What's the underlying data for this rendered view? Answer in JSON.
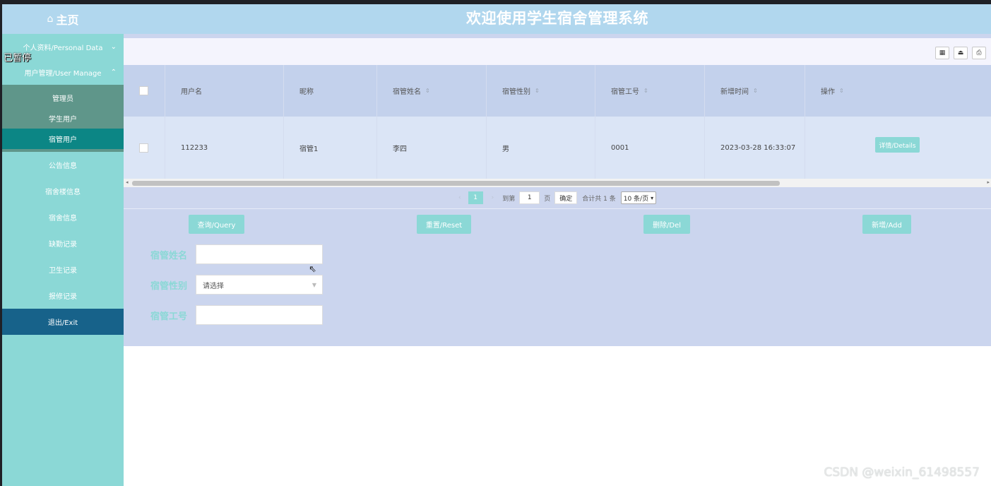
{
  "header": {
    "home_label": "主页",
    "home_icon": "home-icon",
    "title": "欢迎使用学生宿舍管理系统"
  },
  "overlay": {
    "paused": "已暂停"
  },
  "sidebar": {
    "personal": {
      "label": "个人资料/Personal Data",
      "chevron": "chevron-down-icon"
    },
    "user_manage": {
      "label": "用户管理/User Manage",
      "chevron": "chevron-up-icon"
    },
    "sub_items": [
      "管理员",
      "学生用户",
      "宿管用户"
    ],
    "active_sub_index": 2,
    "items": [
      "公告信息",
      "宿舍楼信息",
      "宿舍信息",
      "缺勤记录",
      "卫生记录",
      "报修记录"
    ],
    "exit_label": "退出/Exit"
  },
  "toolbar": {
    "icons": [
      "qr-code-icon",
      "export-icon",
      "print-icon"
    ]
  },
  "table": {
    "headers": [
      "用户名",
      "昵称",
      "宿管姓名",
      "宿管性别",
      "宿管工号",
      "新增时间",
      "操作"
    ],
    "rows": [
      {
        "username": "112233",
        "nickname": "宿管1",
        "name": "李四",
        "gender": "男",
        "work_no": "0001",
        "created": "2023-03-28 16:33:07",
        "action": "详情/Details"
      }
    ]
  },
  "pager": {
    "prev": "‹",
    "current_page": "1",
    "next": "›",
    "goto_label": "到第",
    "goto_value": "1",
    "page_unit": "页",
    "confirm": "确定",
    "total": "合计共 1 条",
    "page_size": "10 条/页"
  },
  "actions": {
    "query": "查询/Query",
    "reset": "重置/Reset",
    "delete": "删除/Del",
    "add": "新增/Add"
  },
  "form": {
    "name_label": "宿管姓名",
    "name_value": "",
    "gender_label": "宿管性别",
    "gender_placeholder": "请选择",
    "work_no_label": "宿管工号",
    "work_no_value": ""
  },
  "watermark": "CSDN @weixin_61498557",
  "colors": {
    "header": "#b1d7ee",
    "sidebar": "#8bd8d6",
    "active_sub": "#0c8685",
    "exit": "#17628a",
    "panel": "#cbd5ee"
  }
}
